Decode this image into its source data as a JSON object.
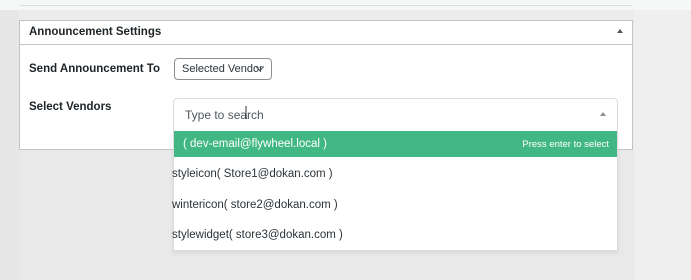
{
  "panel": {
    "title": "Announcement Settings"
  },
  "send_to": {
    "label": "Send Announcement To",
    "selected": "Selected Vendor"
  },
  "vendors": {
    "label": "Select Vendors",
    "placeholder": "Type to search",
    "hint": "Press enter to select",
    "options": [
      "( dev-email@flywheel.local )",
      "styleicon( Store1@dokan.com )",
      "wintericon( store2@dokan.com )",
      "stylewidget( store3@dokan.com )"
    ]
  },
  "colors": {
    "highlight": "#41b883",
    "panel_border": "#c3c4c7"
  }
}
